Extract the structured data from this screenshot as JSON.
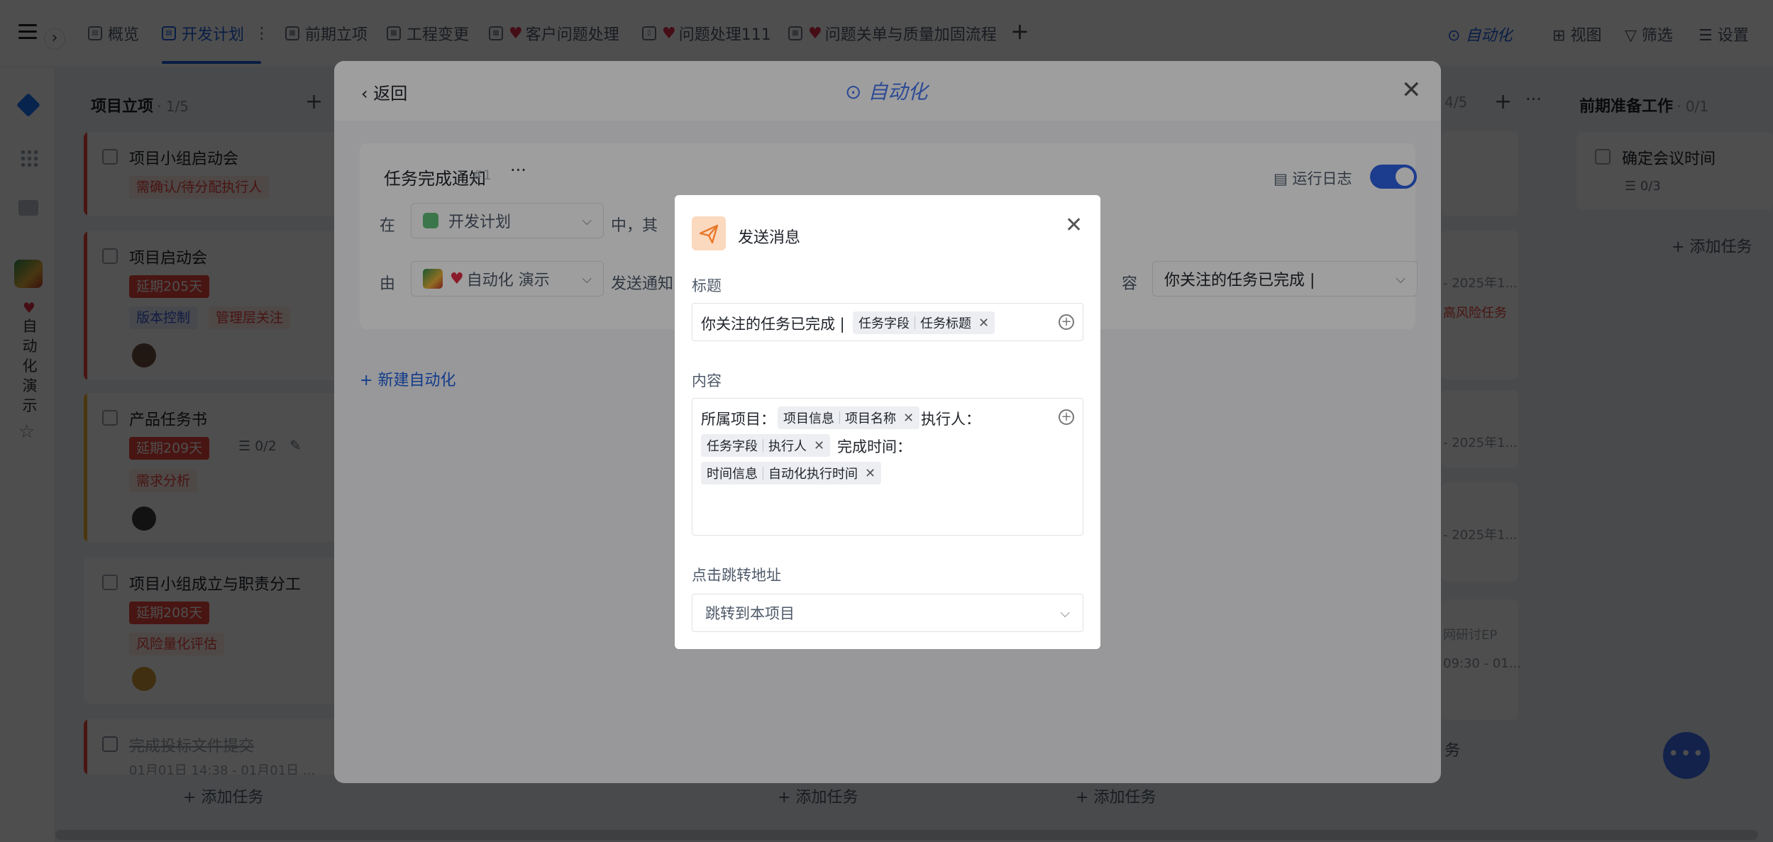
{
  "topbar": {
    "tabs": [
      {
        "label": "概览",
        "icon": "overview-icon"
      },
      {
        "label": "开发计划",
        "icon": "plan-icon",
        "more": "⋮"
      },
      {
        "label": "前期立项",
        "icon": "table-icon"
      },
      {
        "label": "工程变更",
        "icon": "table-icon"
      },
      {
        "label": "客户问题处理",
        "icon": "table-icon"
      },
      {
        "label": "问题处理111",
        "icon": "doc-icon"
      },
      {
        "label": "问题关单与质量加固流程",
        "icon": "table-icon"
      }
    ],
    "add_tab": "+",
    "automation_label": "自动化",
    "view_label": "视图",
    "filter_label": "筛选",
    "settings_label": "设置"
  },
  "leftbar": {
    "workspace_name_chars": [
      "自",
      "动",
      "化",
      "演",
      "示"
    ]
  },
  "board": {
    "col1": {
      "title": "项目立项",
      "count": "· 1/5",
      "cards": [
        {
          "title": "项目小组启动会",
          "tags": [
            "需确认/待分配执行人"
          ]
        },
        {
          "title": "项目启动会",
          "delay": "延期205天",
          "tags": [
            "版本控制",
            "管理层关注"
          ]
        },
        {
          "title": "产品任务书",
          "delay": "延期209天",
          "subtasks": "0/2",
          "tags": [
            "需求分析"
          ]
        },
        {
          "title": "项目小组成立与职责分工",
          "delay": "延期208天",
          "tags": [
            "风险量化评估"
          ]
        },
        {
          "title": "完成投标文件提交",
          "date": "01月01日 14:38 - 01月01日 ..."
        }
      ],
      "add_task": "添加任务"
    },
    "col3": {
      "count": "4/5",
      "add_task": "添加任务"
    },
    "col4": {
      "add_task": "添加任务"
    },
    "col5": {
      "title": "前期准备工作",
      "count": "· 0/1",
      "cards": [
        {
          "title": "确定会议时间",
          "subtasks": "0/3"
        }
      ],
      "add_task": "添加任务"
    },
    "partial_texts": [
      "- 2025年1...",
      "高风险任务",
      "- 2025年1...",
      "- 2025年1...",
      "网研讨EP",
      "09:30 - 01...",
      "务"
    ]
  },
  "automation": {
    "back_label": "返回",
    "title": "自动化",
    "rule": {
      "name": "任务完成通知",
      "id": "#1",
      "more": "···",
      "run_log": "运行日志",
      "enabled": true,
      "row1_prefix": "在",
      "row1_select": "开发计划",
      "row1_suffix": "中，其",
      "row2_prefix": "由",
      "row2_select": "自动化 演示",
      "row2_text": "发送通知",
      "row2_content_label": "容",
      "row2_content_value": "你关注的任务已完成 |"
    },
    "new_automation": "新建自动化"
  },
  "dialog": {
    "title": "发送消息",
    "title_field_label": "标题",
    "title_text": "你关注的任务已完成 |",
    "title_chip": {
      "group": "任务字段",
      "field": "任务标题"
    },
    "content_field_label": "内容",
    "content_line1_text": "所属项目：",
    "content_chip1": {
      "group": "项目信息",
      "field": "项目名称"
    },
    "content_line1_text2": "执行人：",
    "content_chip2": {
      "group": "任务字段",
      "field": "执行人"
    },
    "content_line2_text": "完成时间：",
    "content_chip3": {
      "group": "时间信息",
      "field": "自动化执行时间"
    },
    "jump_label": "点击跳转地址",
    "jump_value": "跳转到本项目"
  }
}
